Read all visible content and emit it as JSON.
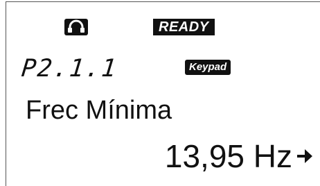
{
  "status": {
    "state": "READY",
    "control_icon": "headset-icon"
  },
  "parameter": {
    "code": "P2.1.1",
    "source": "Keypad",
    "name": "Frec Mínima",
    "value": "13,95 Hz",
    "arrow_icon": "right-arrow-icon"
  },
  "colors": {
    "background": "#ffffff",
    "foreground": "#111111"
  }
}
